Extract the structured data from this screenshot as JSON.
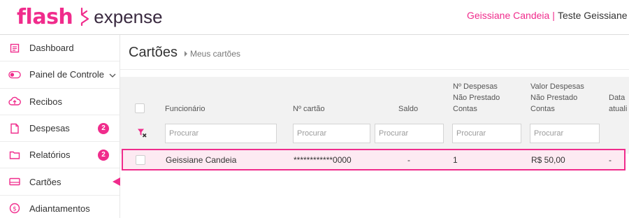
{
  "brand": {
    "logo_left": "flash",
    "logo_right": "expense",
    "accent": "#f02c8c"
  },
  "header": {
    "user_name": "Geissiane Candeia",
    "separator": "|",
    "company": "Teste Geissiane C"
  },
  "sidebar": {
    "items": [
      {
        "label": "Dashboard",
        "icon": "dashboard-icon"
      },
      {
        "label": "Painel de Controle",
        "icon": "toggle-icon"
      },
      {
        "label": "Recibos",
        "icon": "cloud-upload-icon"
      },
      {
        "label": "Despesas",
        "icon": "file-icon",
        "badge": "2"
      },
      {
        "label": "Relatórios",
        "icon": "folder-icon",
        "badge": "2"
      },
      {
        "label": "Cartões",
        "icon": "card-icon",
        "active": true
      },
      {
        "label": "Adiantamentos",
        "icon": "dollar-icon"
      }
    ]
  },
  "page": {
    "title": "Cartões",
    "breadcrumb": "Meus cartões"
  },
  "table": {
    "columns": {
      "funcionario": "Funcionário",
      "cartao": "Nº cartão",
      "saldo": "Saldo",
      "despesas_line1": "Nº Despesas",
      "despesas_line2": "Não Prestado",
      "despesas_line3": "Contas",
      "valor_line1": "Valor Despesas",
      "valor_line2": "Não Prestado",
      "valor_line3": "Contas",
      "data_line1": "Data",
      "data_line2": "atuali"
    },
    "filter_placeholder": "Procurar",
    "rows": [
      {
        "funcionario": "Geissiane Candeia",
        "cartao": "************0000",
        "saldo": "-",
        "despesas": "1",
        "valor": "R$ 50,00",
        "data": "-"
      }
    ]
  }
}
